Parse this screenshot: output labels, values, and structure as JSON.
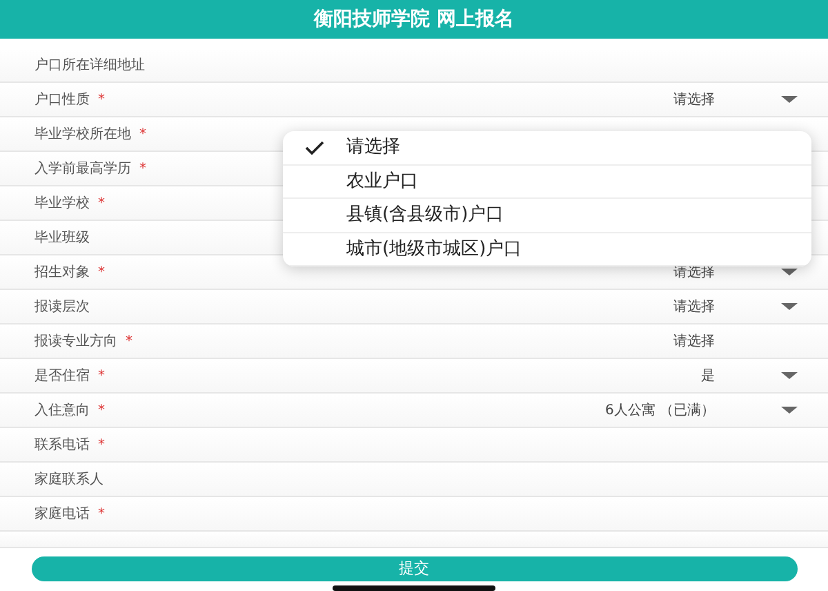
{
  "header": {
    "title": "衡阳技师学院 网上报名"
  },
  "fields": [
    {
      "label": "户口所在详细地址",
      "dropdown": false
    },
    {
      "label": "户口性质",
      "required_mark": "*",
      "value": "请选择",
      "dropdown": true
    },
    {
      "label": "毕业学校所在地",
      "required_mark": "*",
      "dropdown": false
    },
    {
      "label": "入学前最高学历",
      "required_mark": "*",
      "dropdown": false
    },
    {
      "label": "毕业学校",
      "required_mark": "*",
      "dropdown": false
    },
    {
      "label": "毕业班级",
      "dropdown": false
    },
    {
      "label": "招生对象",
      "required_mark": "*",
      "value": "请选择",
      "dropdown": true
    },
    {
      "label": "报读层次",
      "value": "请选择",
      "dropdown": true
    },
    {
      "label": "报读专业方向",
      "required_mark": "*",
      "value": "请选择",
      "dropdown": false
    },
    {
      "label": "是否住宿",
      "required_mark": "*",
      "value": "是",
      "dropdown": true
    },
    {
      "label": "入住意向",
      "required_mark": "*",
      "value": "6人公寓 （已满）",
      "dropdown": true
    },
    {
      "label": "联系电话",
      "required_mark": "*",
      "dropdown": false
    },
    {
      "label": "家庭联系人",
      "dropdown": false
    },
    {
      "label": "家庭电话",
      "required_mark": "*",
      "dropdown": false
    }
  ],
  "dropdown_menu": [
    {
      "label": "请选择",
      "selected": true
    },
    {
      "label": "农业户口",
      "selected": false
    },
    {
      "label": "县镇(含县级市)户口",
      "selected": false
    },
    {
      "label": "城市(地级市城区)户口",
      "selected": false
    }
  ],
  "submit_button": "提交"
}
